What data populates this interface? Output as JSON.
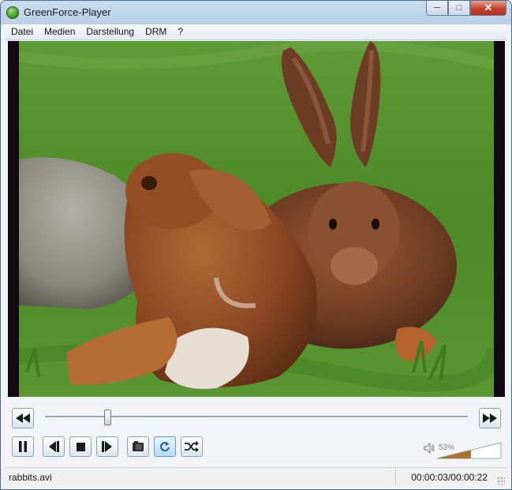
{
  "window": {
    "title": "GreenForce-Player"
  },
  "window_buttons": {
    "minimize": "─",
    "maximize": "□",
    "close": "✕"
  },
  "menu": [
    {
      "label": "Datei"
    },
    {
      "label": "Medien"
    },
    {
      "label": "Darstellung"
    },
    {
      "label": "DRM"
    },
    {
      "label": "?"
    }
  ],
  "video": {
    "content": "rabbits"
  },
  "playback": {
    "position_fraction": 0.148
  },
  "volume": {
    "label": "53%",
    "level": 0.53
  },
  "status": {
    "file": "rabbits.avi",
    "time": "00:00:03/00:00:22"
  },
  "icons": {
    "rewind": "rewind-icon",
    "forward": "fast-forward-icon",
    "pause": "pause-icon",
    "prev": "previous-frame-icon",
    "stop": "stop-icon",
    "next": "next-frame-icon",
    "snapshot": "snapshot-icon",
    "repeat": "repeat-icon",
    "shuffle": "shuffle-icon",
    "speaker": "speaker-icon"
  },
  "colors": {
    "accent_active": "#b6dcf7",
    "grass": "#4f8f2c",
    "rabbit": "#8b4a24",
    "close": "#c7432b"
  }
}
